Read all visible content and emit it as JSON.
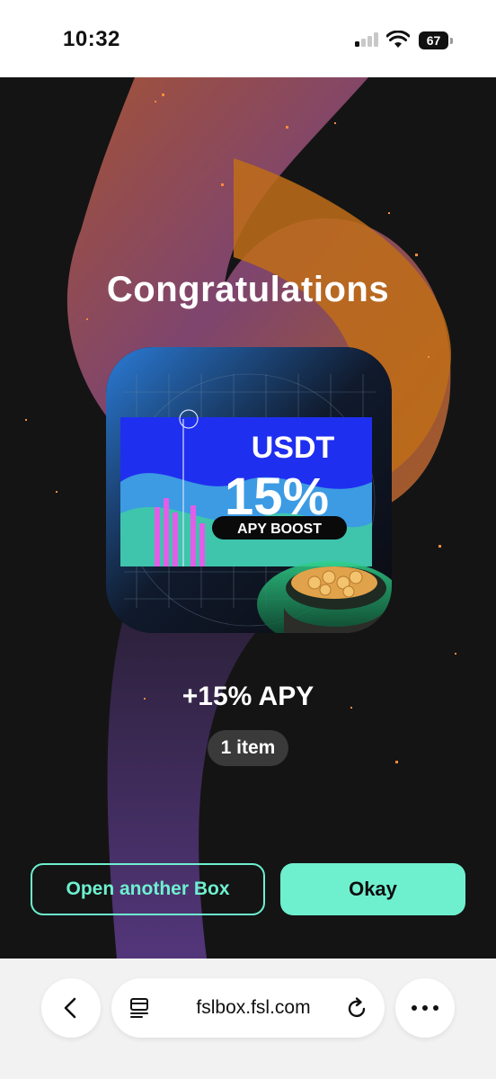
{
  "status_bar": {
    "time": "10:32",
    "battery": "67",
    "icons": [
      "signal-icon",
      "wifi-icon",
      "battery-icon"
    ]
  },
  "reward": {
    "heading": "Congratulations",
    "card": {
      "line1": "USDT",
      "line2": "15%",
      "line3": "APY BOOST"
    },
    "title": "+15% APY",
    "quantity": "1 item"
  },
  "actions": {
    "secondary_label": "Open another Box",
    "primary_label": "Okay"
  },
  "browser": {
    "url": "fslbox.fsl.com",
    "icons": [
      "back-icon",
      "page-menu-icon",
      "reload-icon",
      "more-icon"
    ]
  },
  "colors": {
    "accent": "#6ef0cf",
    "background": "#141414",
    "card_blue": "#1f2ff0"
  }
}
